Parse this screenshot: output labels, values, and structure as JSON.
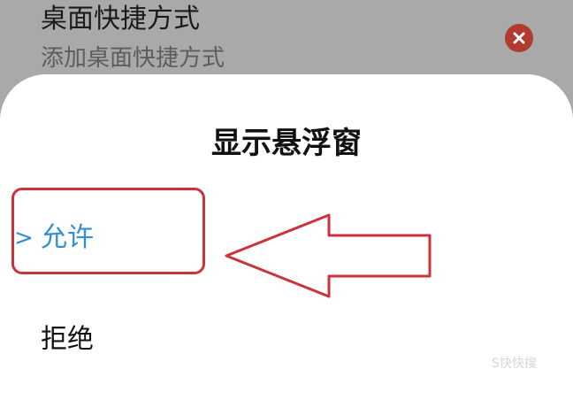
{
  "background_row": {
    "title": "桌面快捷方式",
    "subtitle": "添加桌面快捷方式",
    "close_icon": "close-icon"
  },
  "dialog": {
    "title": "显示悬浮窗",
    "options": [
      {
        "label": "允许",
        "selected": true,
        "indicator": ">"
      },
      {
        "label": "拒绝",
        "selected": false
      }
    ]
  },
  "annotation": {
    "highlight_color": "#c9333c",
    "arrow_icon": "left-arrow-annotation"
  },
  "colors": {
    "accent": "#2e8fd2",
    "overlay": "#a9a9a9",
    "close_button": "#b33a2e"
  },
  "watermark": "S快快搜"
}
